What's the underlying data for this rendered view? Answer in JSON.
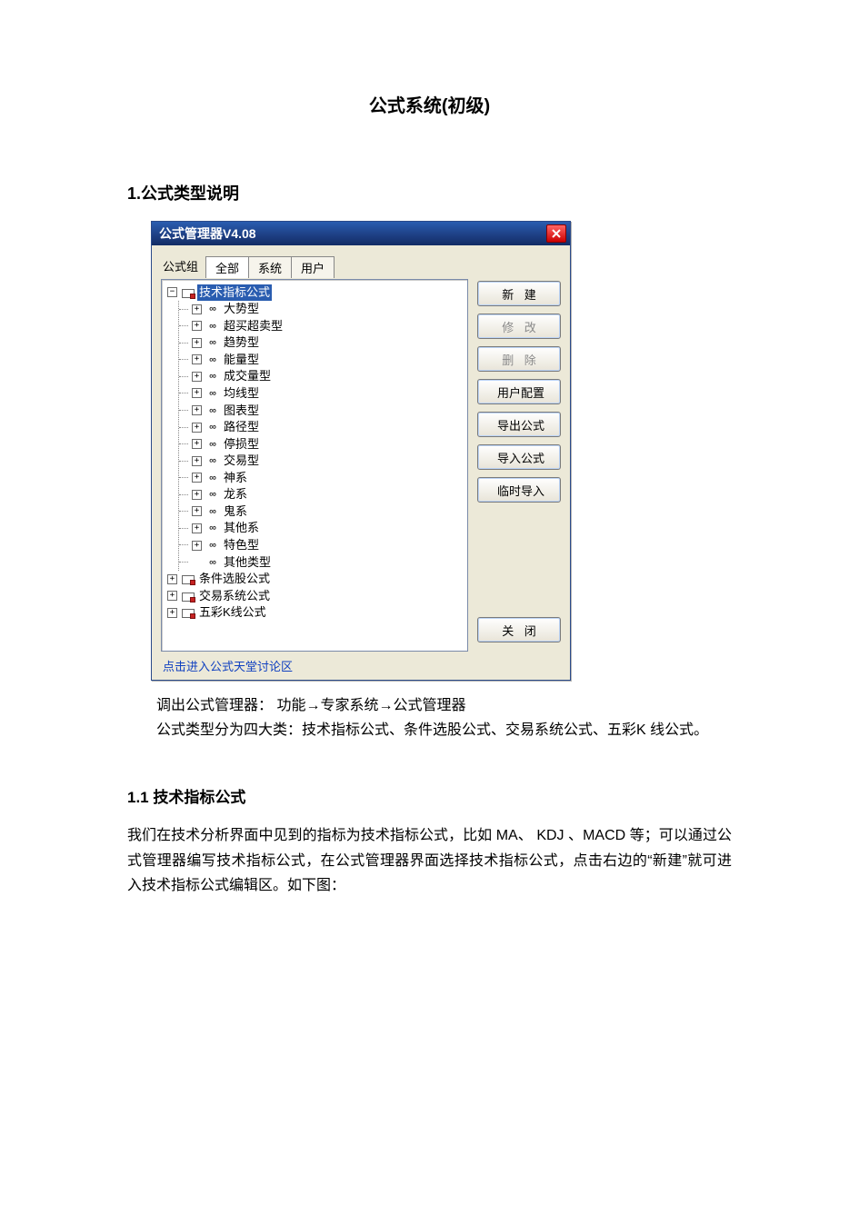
{
  "doc": {
    "title": "公式系统(初级)",
    "section1_heading": "1.公式类型说明",
    "para1_line1": "调出公式管理器：  功能→专家系统→公式管理器",
    "para1_line2": "公式类型分为四大类：技术指标公式、条件选股公式、交易系统公式、五彩K 线公式。",
    "section11_heading": "1.1 技术指标公式",
    "para2": "我们在技术分析界面中见到的指标为技术指标公式，比如 MA、 KDJ 、MACD 等；可以通过公式管理器编写技术指标公式，在公式管理器界面选择技术指标公式，点击右边的“新建”就可进入技术指标公式编辑区。如下图："
  },
  "dialog": {
    "title": "公式管理器V4.08",
    "tabs_label": "公式组",
    "tabs": {
      "all": "全部",
      "system": "系统",
      "user": "用户"
    },
    "buttons": {
      "new": "新 建",
      "edit": "修 改",
      "delete": "删 除",
      "userconf": "用户配置",
      "export": "导出公式",
      "import": "导入公式",
      "tempimport": "临时导入",
      "close": "关 闭"
    },
    "link": "点击进入公式天堂讨论区",
    "tree": {
      "root0": {
        "label": "技术指标公式",
        "children": [
          "大势型",
          "超买超卖型",
          "趋势型",
          "能量型",
          "成交量型",
          "均线型",
          "图表型",
          "路径型",
          "停损型",
          "交易型",
          "神系",
          "龙系",
          "鬼系",
          "其他系",
          "特色型",
          "其他类型"
        ]
      },
      "root1": {
        "label": "条件选股公式"
      },
      "root2": {
        "label": "交易系统公式"
      },
      "root3": {
        "label": "五彩K线公式"
      }
    }
  }
}
